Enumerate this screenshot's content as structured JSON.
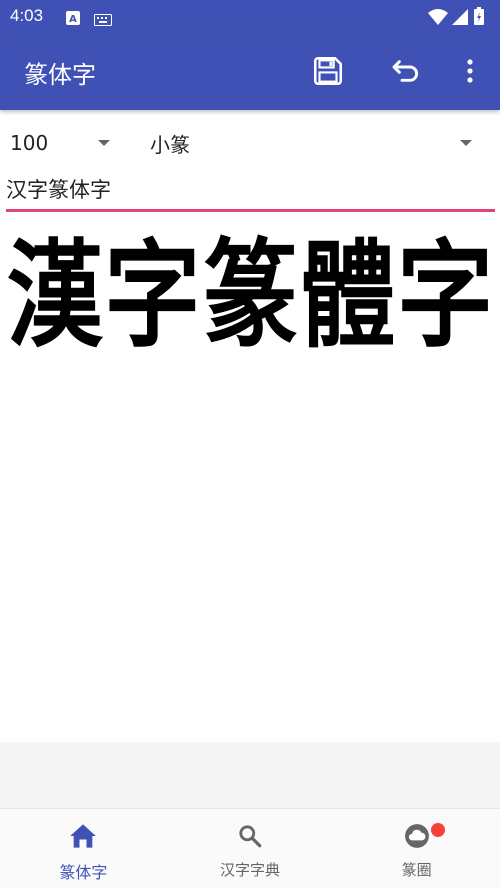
{
  "status_bar": {
    "time": "4:03"
  },
  "app_bar": {
    "title": "篆体字",
    "actions": [
      {
        "name": "save",
        "icon": "save-icon"
      },
      {
        "name": "undo",
        "icon": "undo-icon"
      },
      {
        "name": "more",
        "icon": "more-vert-icon"
      }
    ]
  },
  "controls": {
    "size": {
      "selected": "100"
    },
    "style": {
      "selected": "小篆"
    }
  },
  "input": {
    "value": "汉字篆体字"
  },
  "seal_output": {
    "chars": [
      "漢",
      "字",
      "篆",
      "體",
      "字"
    ]
  },
  "bottom_nav": {
    "items": [
      {
        "label": "篆体字",
        "icon": "home-icon",
        "active": true
      },
      {
        "label": "汉字字典",
        "icon": "search-icon",
        "active": false
      },
      {
        "label": "篆圈",
        "icon": "cloud-icon",
        "active": false,
        "badge": true
      }
    ]
  },
  "colors": {
    "primary": "#3f51b5",
    "accent": "#e0457b",
    "badge": "#f44336"
  }
}
